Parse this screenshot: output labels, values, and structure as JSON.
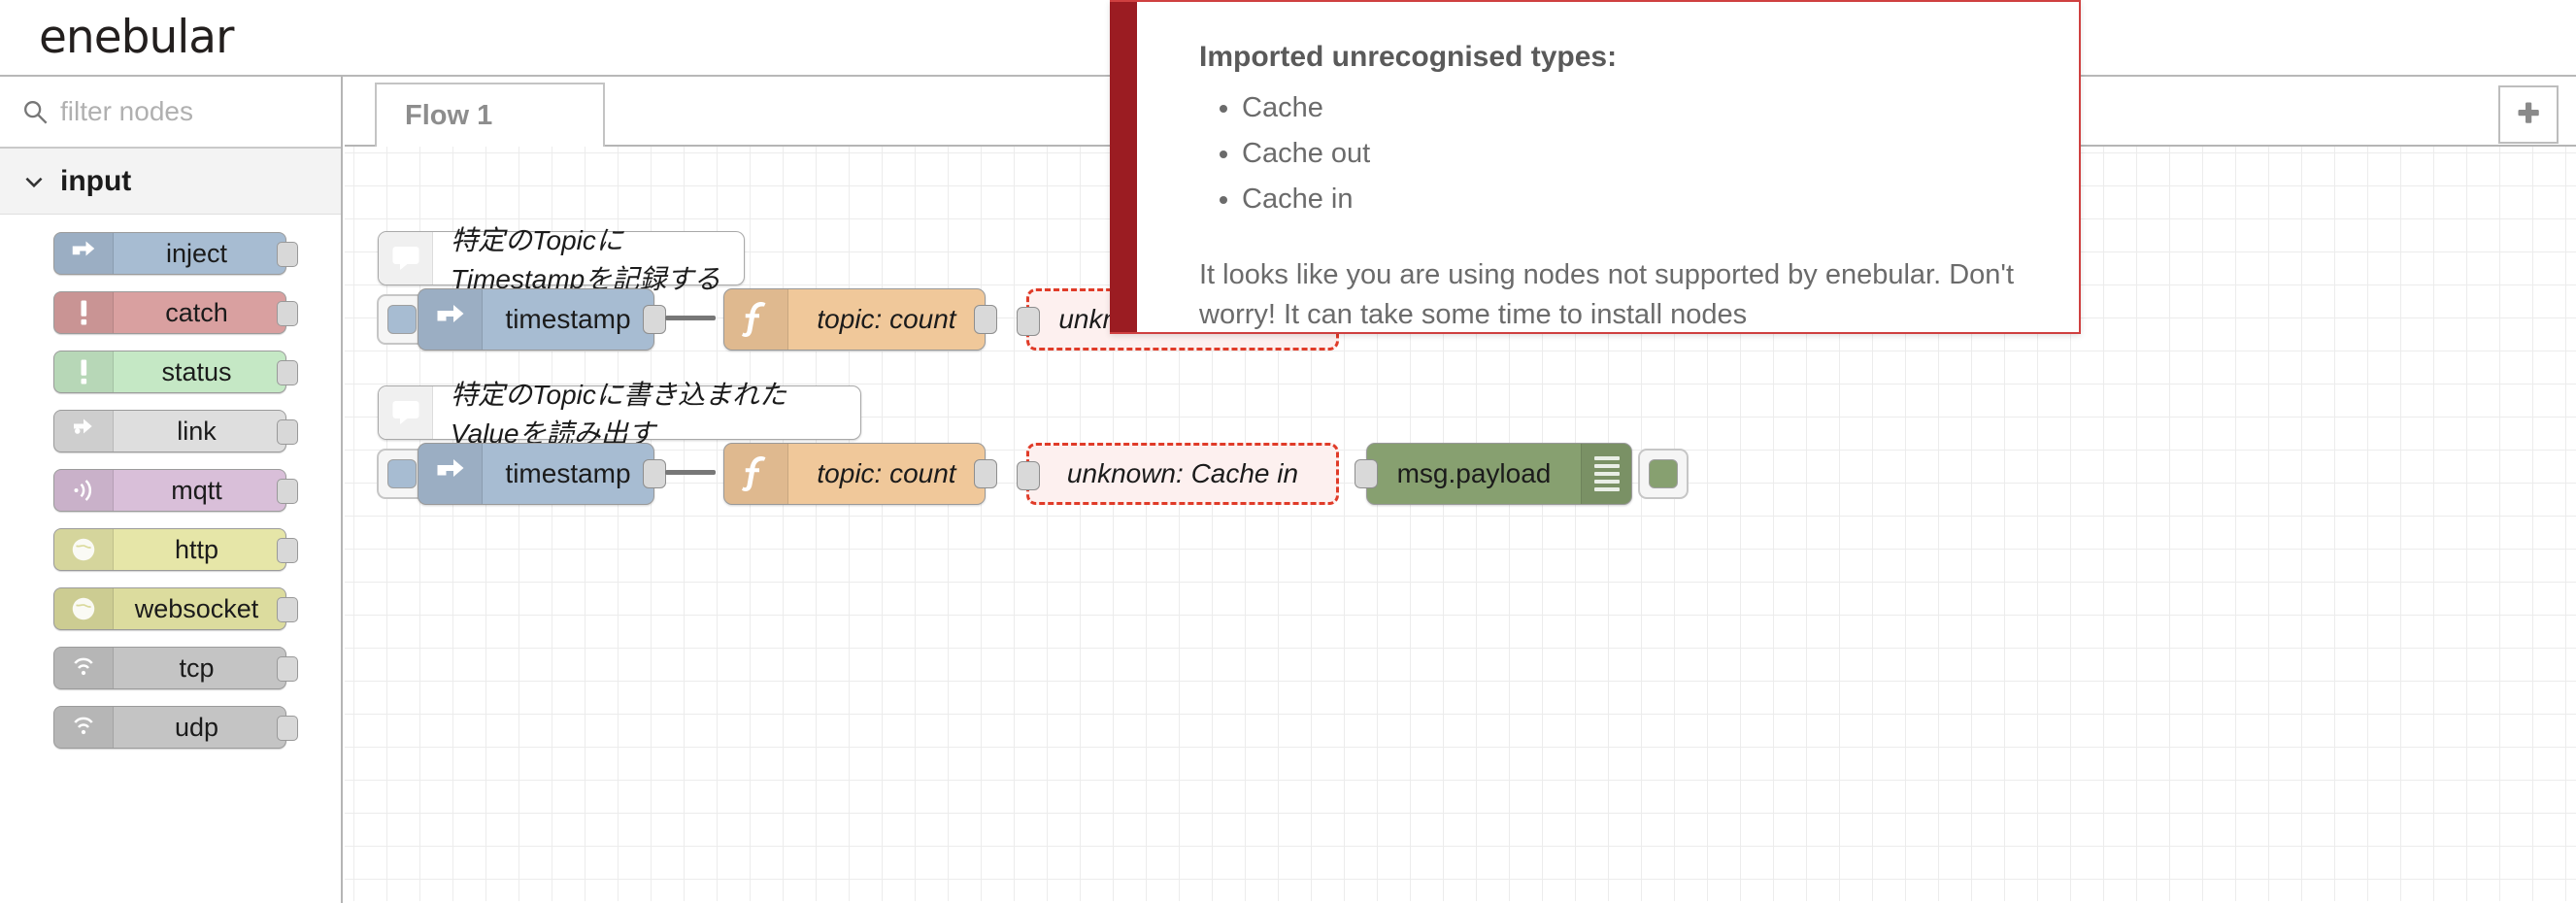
{
  "header": {
    "brand": "enebular"
  },
  "sidebar": {
    "search": {
      "placeholder": "filter nodes",
      "value": "",
      "icon": "search-icon"
    },
    "category": {
      "label": "input",
      "icon": "chevron-down-icon",
      "expanded": true
    },
    "items": [
      {
        "label": "inject",
        "color": "#a7bcd2",
        "icon": "inject-arrow-icon"
      },
      {
        "label": "catch",
        "color": "#d9a0a0",
        "icon": "exclamation-icon"
      },
      {
        "label": "status",
        "color": "#c5e8c5",
        "icon": "exclamation-icon"
      },
      {
        "label": "link",
        "color": "#dedede",
        "icon": "link-arrow-icon"
      },
      {
        "label": "mqtt",
        "color": "#d9bfd9",
        "icon": "signal-waves-icon"
      },
      {
        "label": "http",
        "color": "#e6e6a8",
        "icon": "globe-icon"
      },
      {
        "label": "websocket",
        "color": "#dcdc9e",
        "icon": "globe-icon"
      },
      {
        "label": "tcp",
        "color": "#c4c4c4",
        "icon": "signal-dot-icon"
      },
      {
        "label": "udp",
        "color": "#c4c4c4",
        "icon": "signal-dot-icon"
      }
    ]
  },
  "workspace": {
    "tabs": [
      {
        "label": "Flow 1",
        "active": true
      }
    ],
    "add_tab": {
      "label": "+",
      "icon": "plus-icon"
    },
    "canvas": {
      "comments": [
        {
          "text": "特定のTopicにTimestampを記録する",
          "icon": "comment-icon"
        },
        {
          "text": "特定のTopicに書き込まれたValueを読み出す",
          "icon": "comment-icon"
        }
      ],
      "rows": [
        {
          "inject": {
            "label": "timestamp",
            "color": "#a7bcd2",
            "icon": "inject-arrow-icon"
          },
          "function": {
            "label": "topic: count",
            "color": "#f0c89a",
            "icon": "function-icon"
          },
          "unknown": {
            "label": "unknown: Cache out",
            "border_color": "#e03b28",
            "fill": "#fdf0ef"
          }
        },
        {
          "inject": {
            "label": "timestamp",
            "color": "#a7bcd2",
            "icon": "inject-arrow-icon"
          },
          "function": {
            "label": "topic: count",
            "color": "#f0c89a",
            "icon": "function-icon"
          },
          "unknown": {
            "label": "unknown: Cache in",
            "border_color": "#e03b28",
            "fill": "#fdf0ef"
          },
          "debug": {
            "label": "msg.payload",
            "color": "#87a070",
            "icon": "debug-lines-icon"
          }
        }
      ]
    }
  },
  "notification": {
    "accent_color": "#9b1c22",
    "border_color": "#cf4040",
    "title": "Imported unrecognised types:",
    "items": [
      "Cache",
      "Cache out",
      "Cache in"
    ],
    "message": "It looks like you are using nodes not supported by enebular. Don't worry! It can take some time to install nodes"
  }
}
